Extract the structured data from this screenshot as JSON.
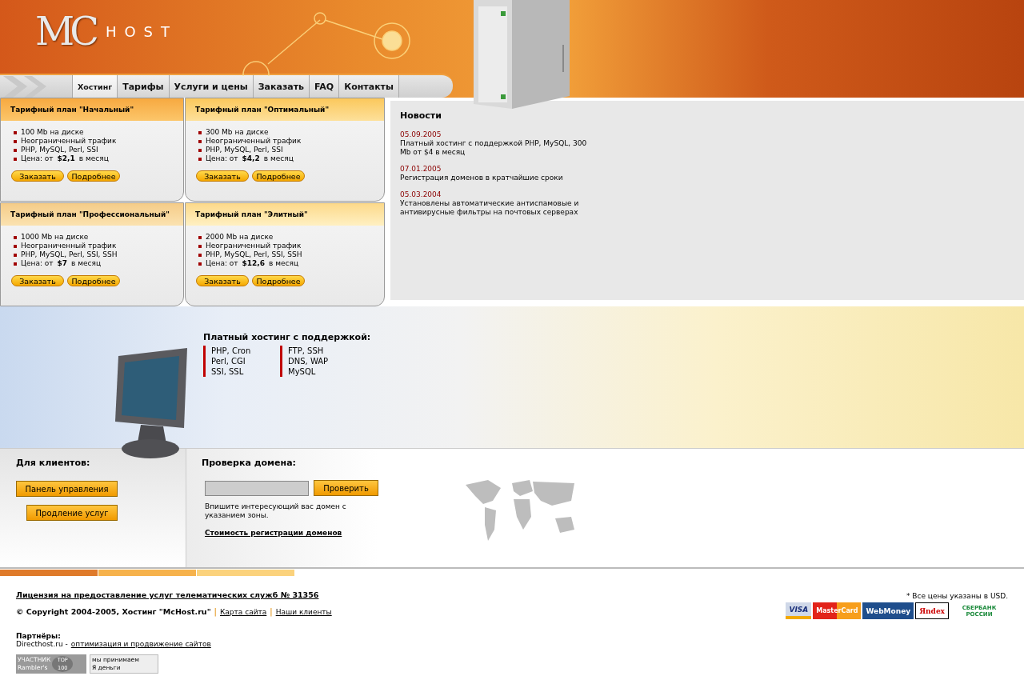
{
  "logo": {
    "mark": "MC",
    "text": "HOST"
  },
  "nav": [
    {
      "label": "Хостинг",
      "selected": true
    },
    {
      "label": "Тарифы",
      "selected": false
    },
    {
      "label": "Услуги и цены",
      "selected": false
    },
    {
      "label": "Заказать",
      "selected": false
    },
    {
      "label": "FAQ",
      "selected": false
    },
    {
      "label": "Контакты",
      "selected": false
    }
  ],
  "plans": [
    {
      "title": "Тарифный план \"Начальный\"",
      "features": [
        "100 Mb на диске",
        "Неограниченный трафик",
        "PHP, MySQL, Perl, SSI",
        "Цена: от **$2,1** в месяц"
      ],
      "buttons": [
        "Заказать",
        "Подробнее"
      ]
    },
    {
      "title": "Тарифный план \"Оптимальный\"",
      "features": [
        "300 Mb на диске",
        "Неограниченный трафик",
        "PHP, MySQL, Perl, SSI",
        "Цена: от **$4,2** в месяц"
      ],
      "buttons": [
        "Заказать",
        "Подробнее"
      ]
    },
    {
      "title": "Тарифный план \"Профессиональный\"",
      "features": [
        "1000 Mb на диске",
        "Неограниченный трафик",
        "PHP, MySQL, Perl, SSI, SSH",
        "Цена: от **$7** в месяц"
      ],
      "buttons": [
        "Заказать",
        "Подробнее"
      ]
    },
    {
      "title": "Тарифный план \"Элитный\"",
      "features": [
        "2000 Mb на диске",
        "Неограниченный трафик",
        "PHP, MySQL, Perl, SSI, SSH",
        "Цена: от **$12,6** в месяц"
      ],
      "buttons": [
        "Заказать",
        "Подробнее"
      ]
    }
  ],
  "news": {
    "title": "Новости",
    "items": [
      {
        "date": "05.09.2005",
        "text": "Платный хостинг с поддержкой PHP, MySQL, 300 Mb от $4 в месяц"
      },
      {
        "date": "07.01.2005",
        "text": "Регистрация доменов в кратчайшие сроки"
      },
      {
        "date": "05.03.2004",
        "text": "Установлены автоматические антиспамовые и антивирусные фильтры на почтовых серверах"
      }
    ]
  },
  "support": {
    "title": "Платный хостинг с поддержкой:",
    "columns": [
      [
        "PHP, Cron",
        "Perl, CGI",
        "SSI, SSL"
      ],
      [
        "FTP, SSH",
        "DNS, WAP",
        "MySQL"
      ]
    ]
  },
  "clients": {
    "title": "Для клиентов:",
    "buttons": [
      "Панель управления",
      "Продление услуг"
    ]
  },
  "domain_check": {
    "title": "Проверка домена:",
    "button": "Проверить",
    "hint": "Впишите интересующий вас домен с указанием зоны.",
    "link": "Стоимость регистрации доменов"
  },
  "footer": {
    "license": "Лицензия на предоставление услуг телематических служб № 31356",
    "copyright": "© Copyright 2004-2005, Хостинг \"McHost.ru\"",
    "links": [
      "Карта сайта",
      "Наши клиенты"
    ],
    "separator": "|",
    "partners_title": "Партнёры:",
    "partner_name": "Directhost.ru -",
    "partner_link": "оптимизация и продвижение сайтов",
    "badges": [
      {
        "lines": [
          "УЧАСТНИК",
          "Rambler's"
        ],
        "side": "TOP 100"
      },
      {
        "lines": [
          "мы принимаем",
          "Я деньги"
        ]
      }
    ],
    "price_note": "* Все цены указаны в USD.",
    "payments": [
      {
        "kind": "visa",
        "label": "VISA"
      },
      {
        "kind": "mastercard",
        "label": "MasterCard"
      },
      {
        "kind": "webmoney",
        "label": "WebMoney"
      },
      {
        "kind": "yandex",
        "label": "Яndex"
      },
      {
        "kind": "sberbank",
        "label": "СБЕРБАНК РОССИИ"
      }
    ]
  }
}
